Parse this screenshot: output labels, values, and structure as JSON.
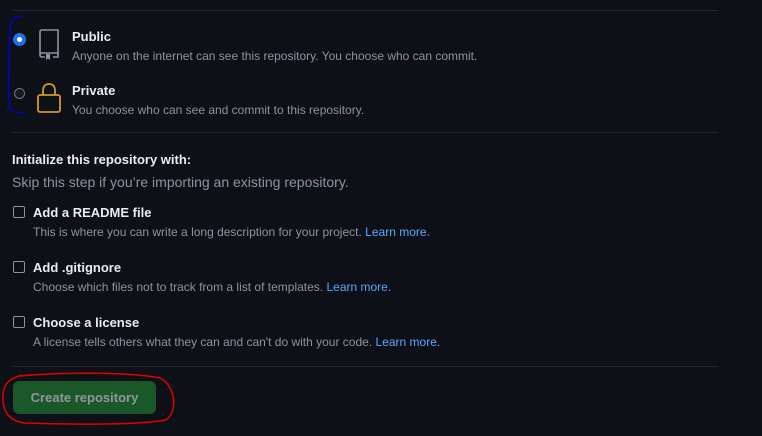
{
  "visibility": {
    "options": [
      {
        "title": "Public",
        "description": "Anyone on the internet can see this repository. You choose who can commit.",
        "icon": "repo-icon",
        "selected": true
      },
      {
        "title": "Private",
        "description": "You choose who can see and commit to this repository.",
        "icon": "lock-icon",
        "selected": false
      }
    ]
  },
  "initialize": {
    "title": "Initialize this repository with:",
    "subtitle": "Skip this step if you’re importing an existing repository.",
    "options": [
      {
        "title": "Add a README file",
        "description": "This is where you can write a long description for your project.",
        "link": "Learn more.",
        "checked": false
      },
      {
        "title": "Add .gitignore",
        "description": "Choose which files not to track from a list of templates.",
        "link": "Learn more.",
        "checked": false
      },
      {
        "title": "Choose a license",
        "description": "A license tells others what they can and can't do with your code.",
        "link": "Learn more.",
        "checked": false
      }
    ]
  },
  "actions": {
    "create_label": "Create repository"
  },
  "colors": {
    "background": "#0d1117",
    "accent": "#1f6feb",
    "link": "#58a6ff",
    "button": "#238636",
    "lock_icon": "#d29922",
    "annotation_blue": "#0000cc",
    "annotation_red": "#e00000"
  }
}
